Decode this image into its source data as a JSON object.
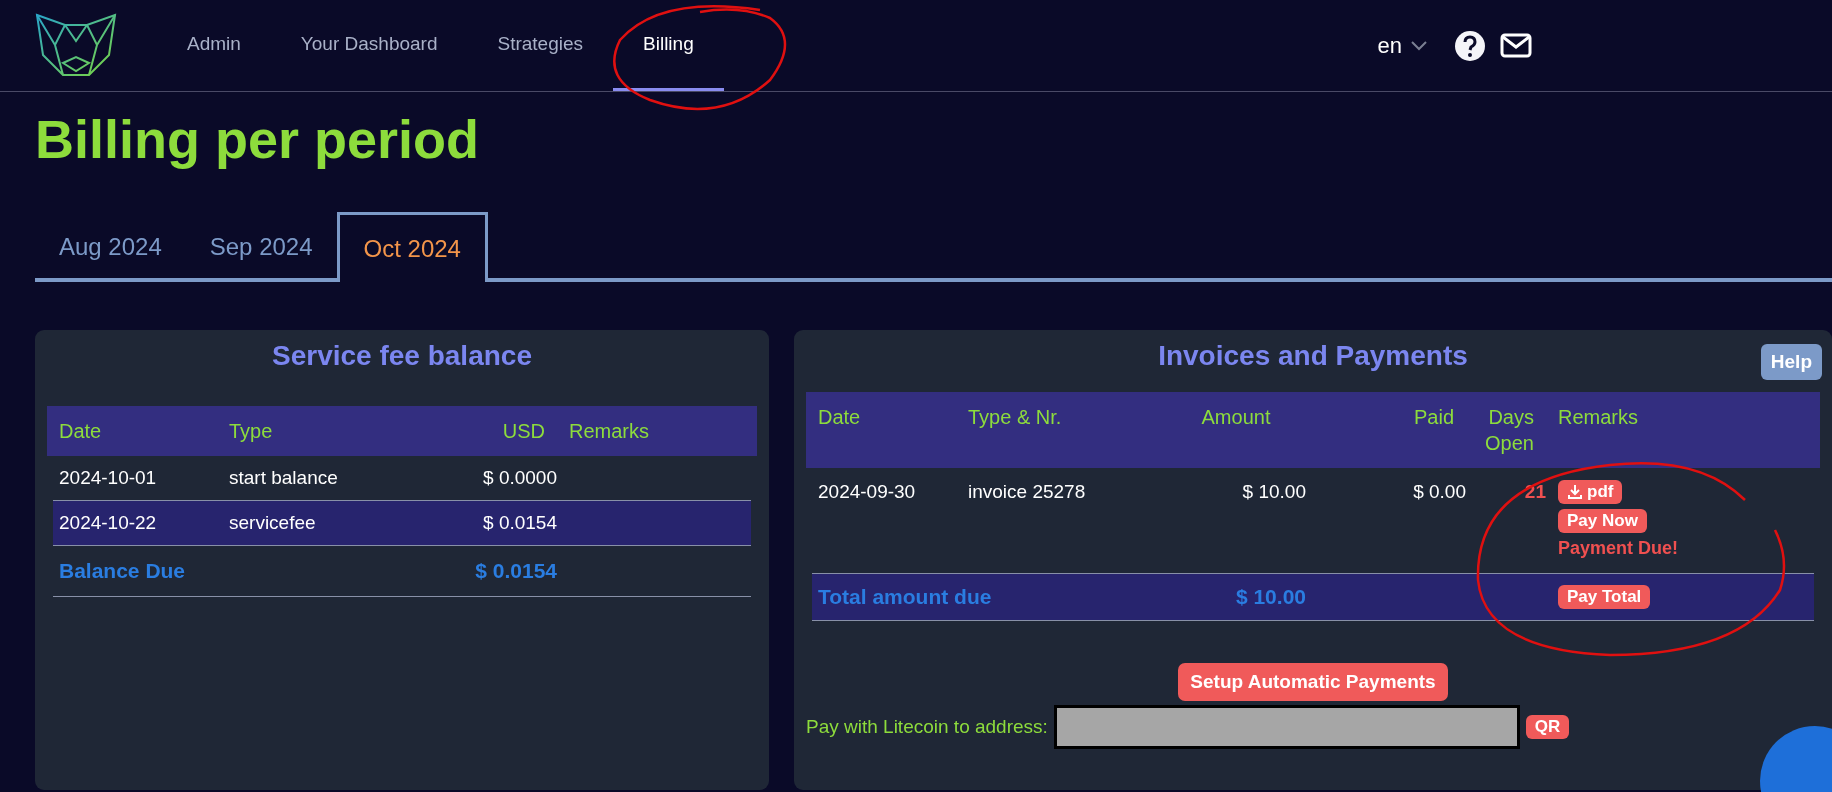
{
  "nav": {
    "items": [
      {
        "label": "Admin",
        "selected": false
      },
      {
        "label": "Your Dashboard",
        "selected": false
      },
      {
        "label": "Strategies",
        "selected": false
      },
      {
        "label": "Billing",
        "selected": true
      }
    ],
    "language": "en"
  },
  "title": "Billing per period",
  "period_tabs": [
    {
      "label": "Aug 2024",
      "selected": false
    },
    {
      "label": "Sep 2024",
      "selected": false
    },
    {
      "label": "Oct 2024",
      "selected": true
    }
  ],
  "balance_panel": {
    "title": "Service fee balance",
    "columns": [
      "Date",
      "Type",
      "USD",
      "Remarks"
    ],
    "rows": [
      {
        "date": "2024-10-01",
        "type": "start balance",
        "usd": "$ 0.0000"
      },
      {
        "date": "2024-10-22",
        "type": "servicefee",
        "usd": "$ 0.0154"
      }
    ],
    "total": {
      "label": "Balance Due",
      "amount": "$ 0.0154"
    }
  },
  "invoices_panel": {
    "title": "Invoices and Payments",
    "help_button": "Help",
    "columns": [
      "Date",
      "Type & Nr.",
      "Amount",
      "Paid",
      "Days Open",
      "Remarks"
    ],
    "rows": [
      {
        "date": "2024-09-30",
        "type_nr": "invoice 25278",
        "amount": "$ 10.00",
        "paid": "$ 0.00",
        "days_open": "21",
        "actions": [
          {
            "kind": "download",
            "label": "pdf"
          },
          {
            "kind": "pay",
            "label": "Pay Now"
          }
        ],
        "remark": "Payment Due!"
      }
    ],
    "total": {
      "label": "Total amount due",
      "amount": "$ 10.00",
      "button": "Pay Total"
    },
    "setup_button": "Setup Automatic Payments",
    "litecoin": {
      "label": "Pay with Litecoin to address:",
      "button": "QR"
    }
  }
}
